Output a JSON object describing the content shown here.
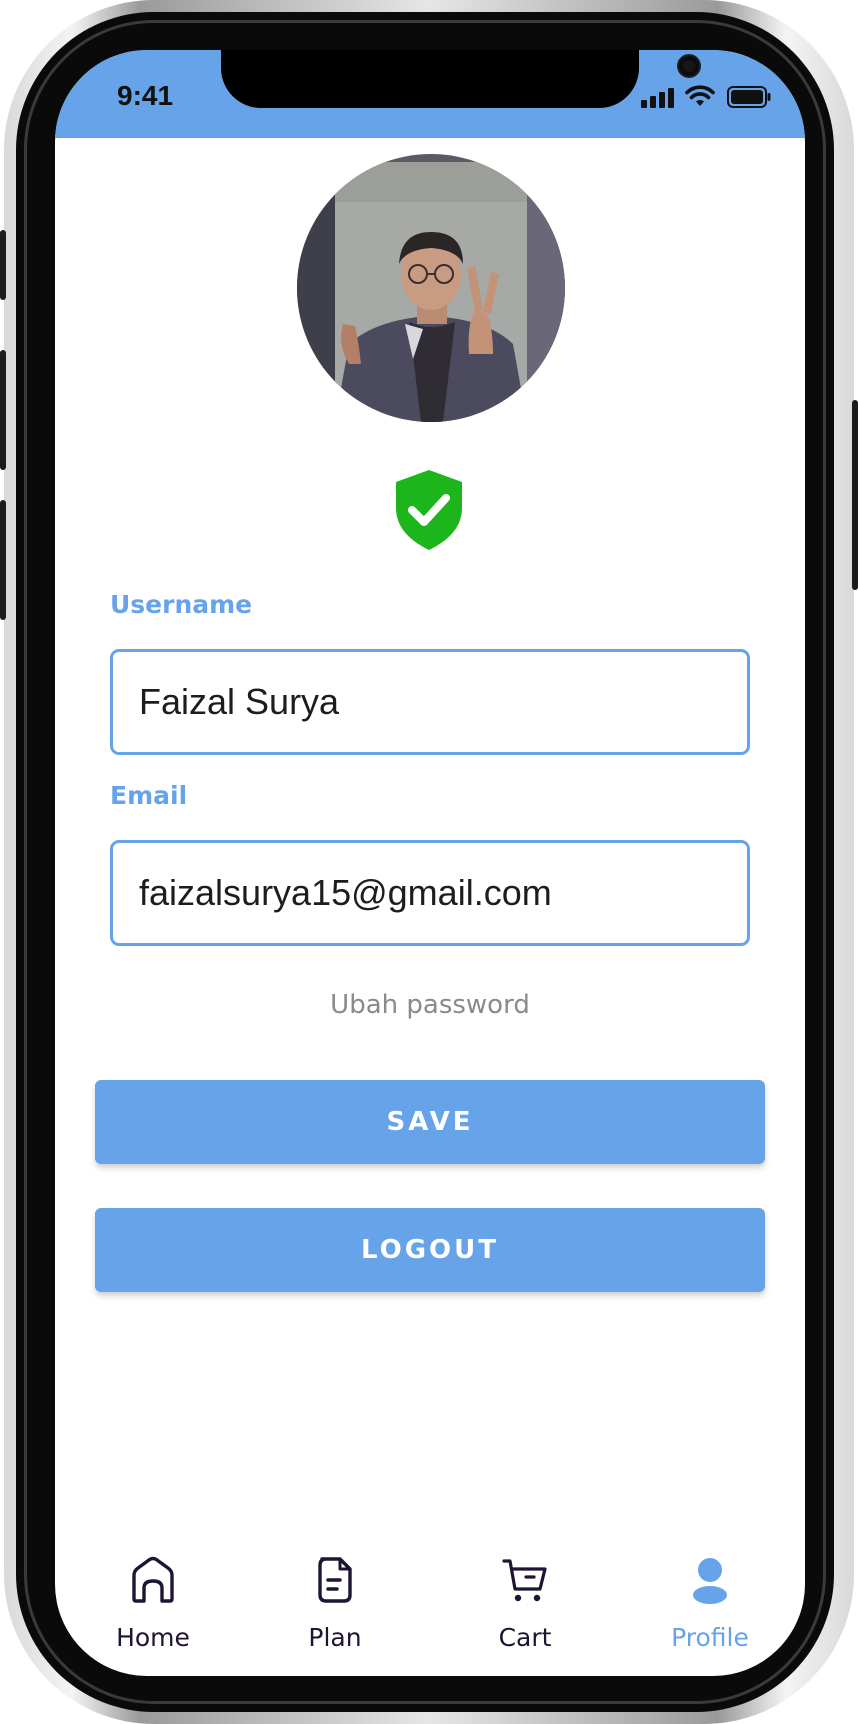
{
  "status_bar": {
    "time": "9:41",
    "background_color": "#67a3e8",
    "icons": [
      "signal-icon",
      "wifi-icon",
      "battery-icon"
    ]
  },
  "profile": {
    "avatar_icon": "profile-photo",
    "verified_icon": "shield-check-icon",
    "verified_color": "#1cb51c"
  },
  "form": {
    "username": {
      "label": "Username",
      "value": "Faizal Surya"
    },
    "email": {
      "label": "Email",
      "value": "faizalsurya15@gmail.com"
    },
    "change_password_link": "Ubah password",
    "save_button": "SAVE",
    "logout_button": "LOGOUT"
  },
  "colors": {
    "accent": "#67a3e8",
    "nav_inactive": "#1f1433",
    "muted_text": "#8a8a8a"
  },
  "bottom_nav": {
    "items": [
      {
        "label": "Home",
        "icon": "home-icon",
        "active": false
      },
      {
        "label": "Plan",
        "icon": "document-icon",
        "active": false
      },
      {
        "label": "Cart",
        "icon": "cart-icon",
        "active": false
      },
      {
        "label": "Profile",
        "icon": "user-icon",
        "active": true
      }
    ]
  }
}
